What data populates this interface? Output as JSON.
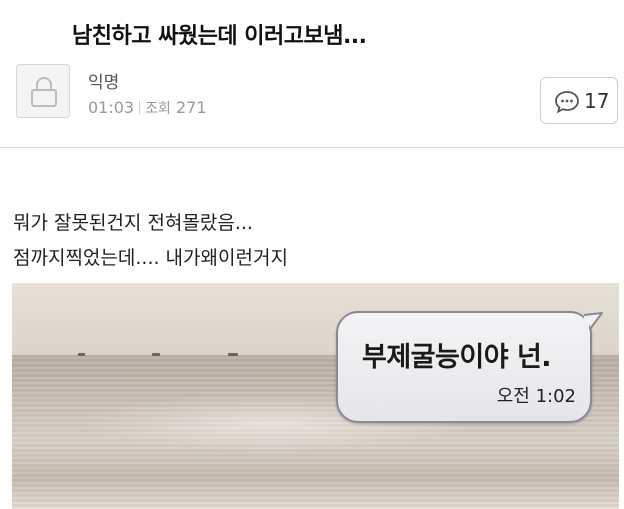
{
  "post": {
    "title": "남친하고 싸웠는데 이러고보냄...",
    "author": "익명",
    "time": "01:03",
    "views_label": "조회",
    "views": "271",
    "comment_count": "17"
  },
  "body": {
    "line1": "뭐가 잘못된건지 전혀몰랐음...",
    "line2": "점까지찍었는데.... 내가왜이런거지"
  },
  "image": {
    "message": "부제굴능이야 넌.",
    "message_time": "오전 1:02"
  },
  "icons": {
    "avatar": "lock-icon",
    "comments": "speech-bubble-icon"
  }
}
